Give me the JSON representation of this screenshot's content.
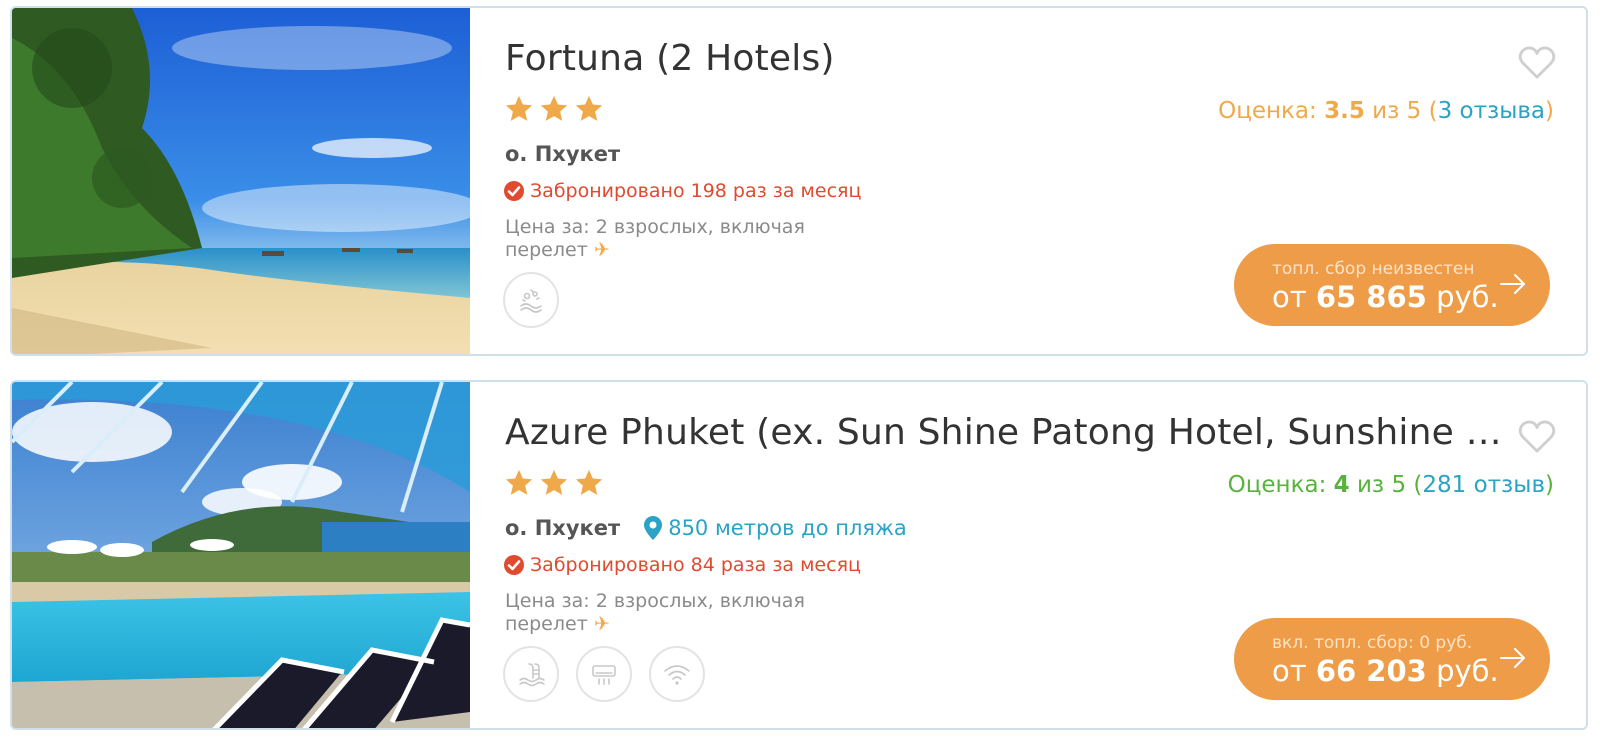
{
  "hotels": [
    {
      "title": "Fortuna (2 Hotels)",
      "stars": 3,
      "rating_label": "Оценка: ",
      "rating_score": "3.5",
      "rating_of": " из 5 (",
      "reviews": "3 отзыва",
      "rating_close": ")",
      "rating_color": "#f0a94a",
      "location": "о. Пхукет",
      "booked": "Забронировано 198 раз за месяц",
      "price_for": "Цена за: 2 взрослых, включая перелет",
      "amenities": [
        "beach-icon"
      ],
      "price_note": "топл. сбор неизвестен",
      "price_prefix": "от ",
      "price_amount": "65 865",
      "price_currency": " руб."
    },
    {
      "title": "Azure Phuket (ex. Sun Shine Patong Hotel, Sunshine Reso...",
      "stars": 3,
      "rating_label": "Оценка: ",
      "rating_score": "4",
      "rating_of": " из 5 (",
      "reviews": "281 отзыв",
      "rating_close": ")",
      "rating_color": "#57b33e",
      "location": "о. Пхукет",
      "beach_distance": "850 метров до пляжа",
      "booked": "Забронировано 84 раза за месяц",
      "price_for": "Цена за: 2 взрослых, включая перелет",
      "amenities": [
        "pool-icon",
        "air-conditioner-icon",
        "wifi-icon"
      ],
      "price_note": "вкл. топл. сбор: 0 руб.",
      "price_prefix": "от ",
      "price_amount": "66 203",
      "price_currency": " руб."
    }
  ],
  "colors": {
    "accent_orange": "#ee9c48",
    "star": "#f0a94a",
    "link_blue": "#2aa3c4",
    "booked_red": "#e04a2f"
  }
}
